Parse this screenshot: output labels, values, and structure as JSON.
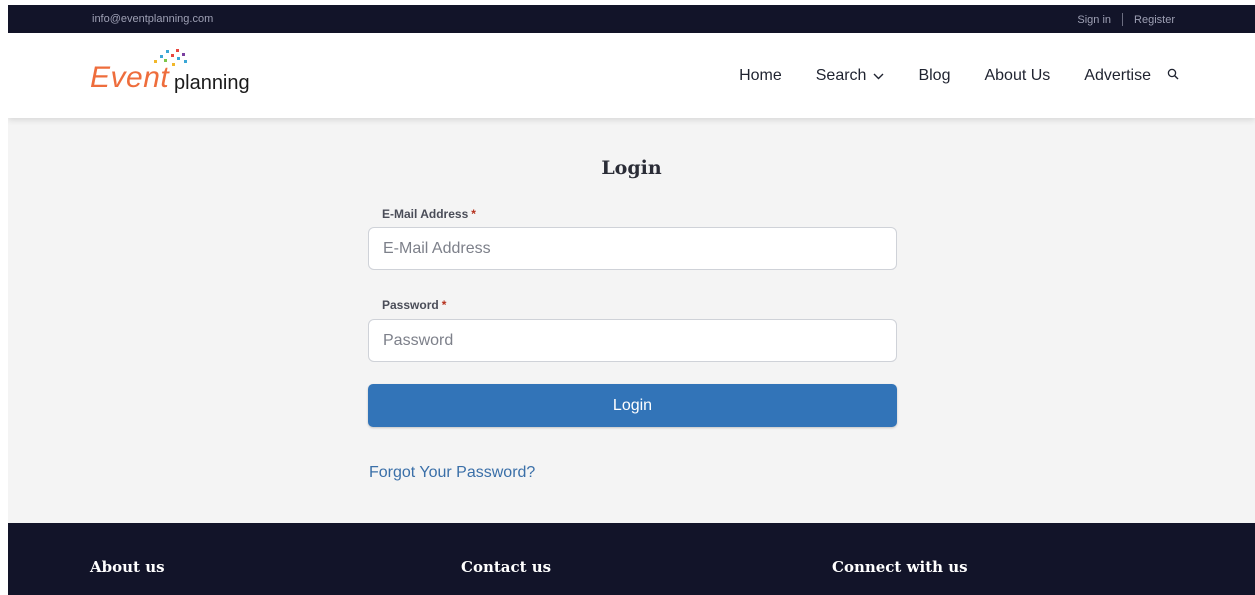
{
  "topbar": {
    "email": "info@eventplanning.com",
    "sign_in": "Sign in",
    "register": "Register"
  },
  "header": {
    "logo_event": "Event",
    "logo_planning": "planning",
    "nav": {
      "home": "Home",
      "search": "Search",
      "blog": "Blog",
      "about": "About Us",
      "advertise": "Advertise"
    }
  },
  "login": {
    "title": "Login",
    "email_label": "E-Mail Address",
    "email_placeholder": "E-Mail Address",
    "password_label": "Password",
    "password_placeholder": "Password",
    "required_mark": "*",
    "submit_label": "Login",
    "forgot_link": "Forgot Your Password?"
  },
  "footer": {
    "about": "About us",
    "contact": "Contact us",
    "connect": "Connect with us"
  },
  "colors": {
    "dark_bar": "#121429",
    "brand_orange": "#ee6d3c",
    "button_blue": "#3274b8",
    "link_blue": "#3a6fa8",
    "page_bg": "#f4f4f4",
    "required_red": "#b5301c"
  },
  "icons": {
    "search_nav": "chevron-down-icon",
    "site_search": "search-icon"
  }
}
